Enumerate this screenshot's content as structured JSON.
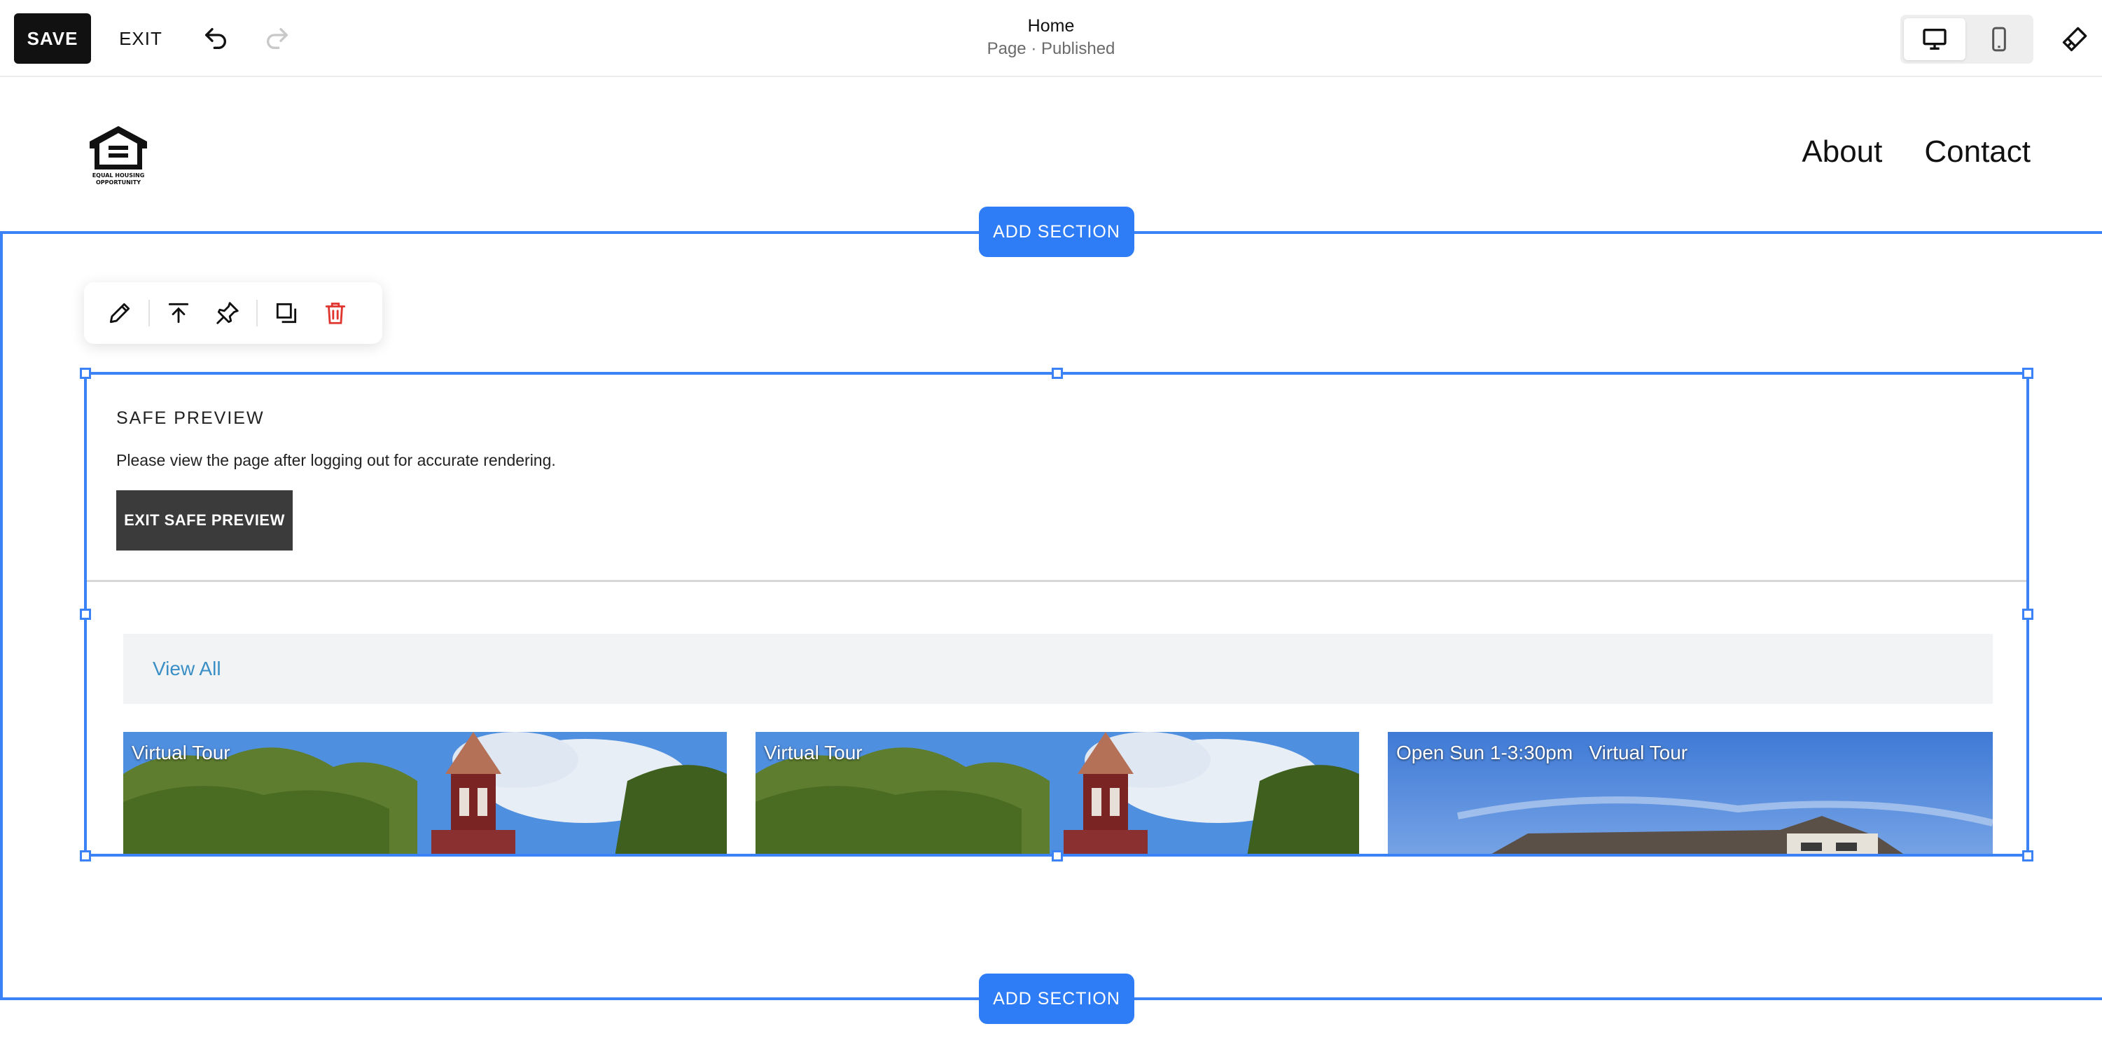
{
  "editor": {
    "save_label": "SAVE",
    "exit_label": "EXIT",
    "page_title": "Home",
    "page_status": "Page · Published"
  },
  "site": {
    "nav": [
      "About",
      "Contact"
    ]
  },
  "section": {
    "add_section_label": "ADD SECTION"
  },
  "safe_preview": {
    "title": "SAFE PREVIEW",
    "message": "Please view the page after logging out for accurate rendering.",
    "button_label": "EXIT SAFE PREVIEW"
  },
  "listings": {
    "view_all_label": "View All",
    "cards": [
      {
        "label": "Virtual Tour"
      },
      {
        "label": "Virtual Tour"
      },
      {
        "label": "Open Sun 1-3:30pm   Virtual Tour"
      }
    ]
  },
  "colors": {
    "accent": "#2f7df6",
    "selection": "#3b82f6",
    "danger": "#e0342f",
    "link": "#3a8fc7"
  },
  "icons": {
    "undo": "undo-icon",
    "redo": "redo-icon",
    "desktop": "desktop-icon",
    "mobile": "mobile-icon",
    "site_styles": "paintbrush-icon",
    "edit": "pencil-icon",
    "move": "move-to-top-icon",
    "pin": "pin-icon",
    "duplicate": "duplicate-icon",
    "delete": "trash-icon"
  }
}
